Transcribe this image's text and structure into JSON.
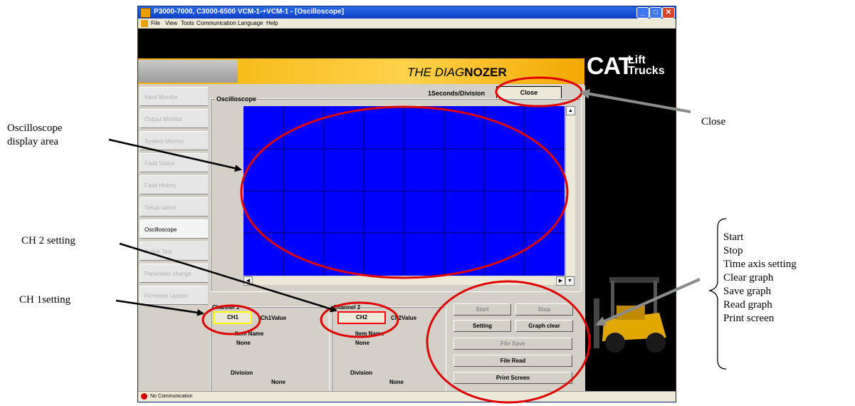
{
  "window": {
    "title": "P3000-7000, C3000-6500 VCM-1-+VCM-1 - [Oscilloscope]",
    "menu": [
      "File",
      "View",
      "Tools",
      "Communication",
      "Language",
      "Help"
    ]
  },
  "branding": {
    "product_prefix": "THE DIAG",
    "product_suffix": "NOZER",
    "logo": "CAT",
    "logo_sub": "Lift Trucks"
  },
  "sidebar": {
    "items": [
      {
        "label": "Input Monitor"
      },
      {
        "label": "Output Monitor"
      },
      {
        "label": "System Monitor"
      },
      {
        "label": "Fault Status"
      },
      {
        "label": "Fault History"
      },
      {
        "label": "Setup option"
      },
      {
        "label": "Oscilloscope"
      },
      {
        "label": "Active Test"
      },
      {
        "label": "Parameter change"
      },
      {
        "label": "Firmware Update"
      }
    ],
    "active_index": 6
  },
  "oscilloscope": {
    "group_label": "Oscilloscope",
    "time_scale": "1Seconds/Division",
    "close_label": "Close",
    "screen_color": "#0000ff",
    "grid_color": "#000066"
  },
  "channel1": {
    "group_label": "Channel 1",
    "button_label": "CH1",
    "value_label": "Ch1Value",
    "item_label": "Item Name",
    "item_value": "None",
    "division_label": "Division",
    "division_value": "None",
    "accent": "#ffff00"
  },
  "channel2": {
    "group_label": "Channel 2",
    "button_label": "CH2",
    "value_label": "Ch2Value",
    "item_label": "Item Name",
    "item_value": "None",
    "division_label": "Division",
    "division_value": "None",
    "accent": "#ff0000"
  },
  "controls": {
    "start": "Start",
    "stop": "Stop",
    "setting": "Setting",
    "graph_clear": "Graph clear",
    "file_save": "File Save",
    "file_read": "File Read",
    "print_screen": "Print Screen"
  },
  "status": {
    "text": "No Communication"
  },
  "annotations": {
    "display_area": [
      "Oscilloscope",
      "display area"
    ],
    "close": "Close",
    "ch2_setting": "CH 2 setting",
    "ch1_setting": "CH 1setting",
    "button_list": [
      "Start",
      "Stop",
      "Time axis setting",
      "Clear graph",
      "Save graph",
      "Read graph",
      "Print screen"
    ],
    "highlight_color": "#e00000",
    "arrow_color": "#000000",
    "close_arrow_color": "#8c8c8c"
  }
}
